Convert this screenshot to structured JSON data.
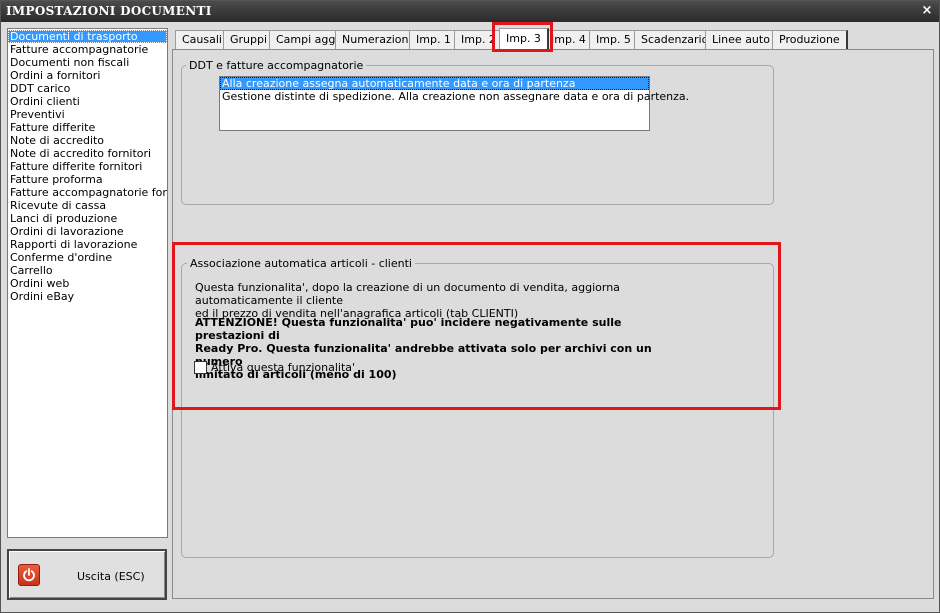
{
  "window": {
    "title": "IMPOSTAZIONI DOCUMENTI",
    "close_glyph": "×"
  },
  "sidebar": {
    "selected_index": 0,
    "items": [
      "Documenti di trasporto",
      "Fatture accompagnatorie",
      "Documenti non fiscali",
      "Ordini a fornitori",
      "DDT carico",
      "Ordini clienti",
      "Preventivi",
      "Fatture differite",
      "Note di accredito",
      "Note di accredito fornitori",
      "Fatture differite fornitori",
      "Fatture proforma",
      "Fatture accompagnatorie fornito",
      "Ricevute di cassa",
      "Lanci di produzione",
      "Ordini di lavorazione",
      "Rapporti di lavorazione",
      "Conferme d'ordine",
      "Carrello",
      "Ordini web",
      "Ordini eBay"
    ]
  },
  "exit_button": {
    "label": "Uscita (ESC)",
    "icon": "power-icon",
    "icon_color": "#e04a2c"
  },
  "tabs": {
    "active": "Imp. 3",
    "labels": [
      "Causali",
      "Gruppi",
      "Campi agg.",
      "Numerazioni",
      "Imp. 1",
      "Imp. 2",
      "Imp. 3",
      "Imp. 4",
      "Imp. 5",
      "Scadenzario",
      "Linee auto",
      "Produzione"
    ]
  },
  "ddt_group": {
    "title": "DDT e fatture accompagnatorie",
    "selected_index": 0,
    "options": [
      "Alla creazione assegna automaticamente data e ora di partenza",
      "Gestione distinte di spedizione. Alla creazione non assegnare data e ora di partenza."
    ]
  },
  "assoc_group": {
    "title": "Associazione automatica articoli - clienti",
    "description_line1": "Questa funzionalita', dopo la creazione di un documento di vendita, aggiorna automaticamente il cliente",
    "description_line2": "ed il prezzo di vendita nell'anagrafica articoli (tab CLIENTI)",
    "warning_line1": "ATTENZIONE! Questa funzionalita' puo' incidere negativamente sulle prestazioni di",
    "warning_line2": "Ready Pro. Questa funzionalita' andrebbe attivata solo per archivi con un numero",
    "warning_line3": "limitato di articoli (meno di 100)",
    "checkbox_label": "Attiva questa funzionalita'",
    "checkbox_checked": false
  },
  "colors": {
    "highlight": "#e0161d",
    "selection": "#3399ff"
  }
}
